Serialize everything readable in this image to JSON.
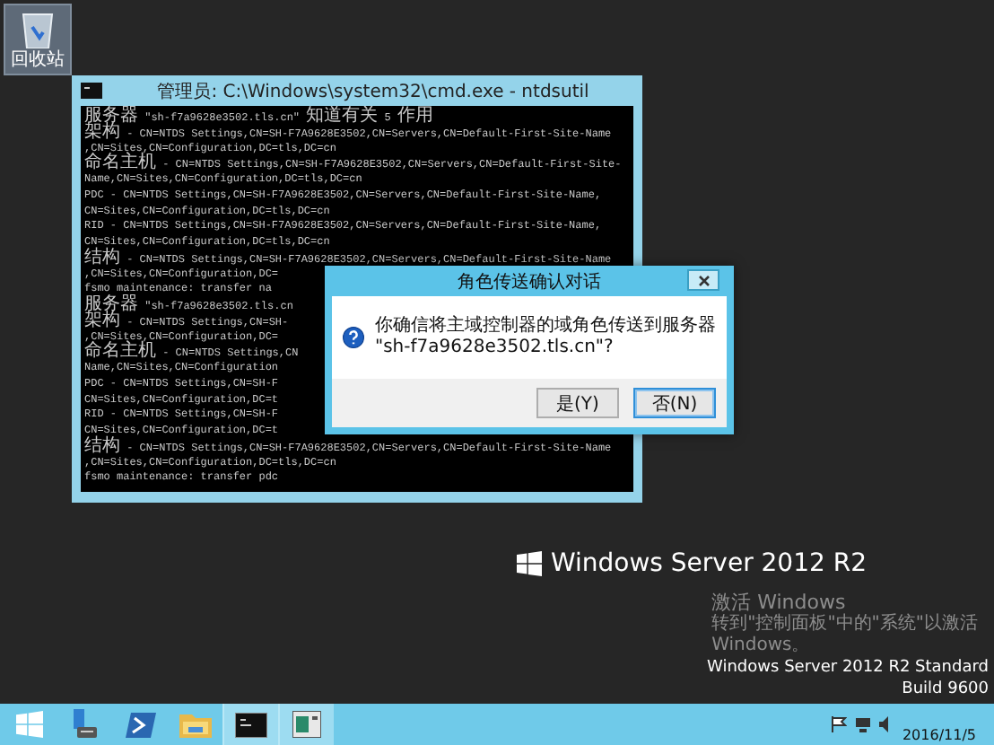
{
  "desktop_icons": [
    {
      "label": "回收站",
      "selected": true
    }
  ],
  "cmd_window": {
    "title": "管理员: C:\\Windows\\system32\\cmd.exe - ntdsutil",
    "lines": [
      "服务器 \"sh-f7a9628e3502.tls.cn\" 知道有关 5 作用",
      "架构 - CN=NTDS Settings,CN=SH-F7A9628E3502,CN=Servers,CN=Default-First-Site-Name",
      ",CN=Sites,CN=Configuration,DC=tls,DC=cn",
      "命名主机 - CN=NTDS Settings,CN=SH-F7A9628E3502,CN=Servers,CN=Default-First-Site-",
      "Name,CN=Sites,CN=Configuration,DC=tls,DC=cn",
      "PDC - CN=NTDS Settings,CN=SH-F7A9628E3502,CN=Servers,CN=Default-First-Site-Name,",
      "CN=Sites,CN=Configuration,DC=tls,DC=cn",
      "RID - CN=NTDS Settings,CN=SH-F7A9628E3502,CN=Servers,CN=Default-First-Site-Name,",
      "CN=Sites,CN=Configuration,DC=tls,DC=cn",
      "结构 - CN=NTDS Settings,CN=SH-F7A9628E3502,CN=Servers,CN=Default-First-Site-Name",
      ",CN=Sites,CN=Configuration,DC=",
      "fsmo maintenance: transfer na",
      "服务器 \"sh-f7a9628e3502.tls.cn",
      "架构 - CN=NTDS Settings,CN=SH-",
      ",CN=Sites,CN=Configuration,DC=",
      "命名主机 - CN=NTDS Settings,CN",
      "Name,CN=Sites,CN=Configuration",
      "PDC - CN=NTDS Settings,CN=SH-F",
      "CN=Sites,CN=Configuration,DC=t",
      "RID - CN=NTDS Settings,CN=SH-F",
      "CN=Sites,CN=Configuration,DC=t",
      "结构 - CN=NTDS Settings,CN=SH-F7A9628E3502,CN=Servers,CN=Default-First-Site-Name",
      ",CN=Sites,CN=Configuration,DC=tls,DC=cn",
      "fsmo maintenance: transfer pdc"
    ]
  },
  "dialog": {
    "title": "角色传送确认对话",
    "message_lines": [
      "你确信将主域控制器的域角色传送到服务器",
      "\"sh-f7a9628e3502.tls.cn\"?"
    ],
    "buttons": [
      {
        "label": "是(Y)",
        "focused": false
      },
      {
        "label": "否(N)",
        "focused": true
      }
    ]
  },
  "branding": {
    "product": "Windows Server 2012 R2",
    "activate_title": "激活 Windows",
    "activate_hint": "转到\"控制面板\"中的\"系统\"以激活",
    "activate_hint_2": "Windows。",
    "edition": "Windows Server 2012 R2 Standard",
    "build": "Build 9600"
  },
  "taskbar": {
    "apps": [
      {
        "kind": "start",
        "active": false
      },
      {
        "kind": "server-manager",
        "active": false
      },
      {
        "kind": "powershell",
        "active": false
      },
      {
        "kind": "explorer",
        "active": false
      },
      {
        "kind": "console",
        "active": true
      },
      {
        "kind": "window",
        "active": true
      }
    ],
    "date": "2016/11/5"
  }
}
